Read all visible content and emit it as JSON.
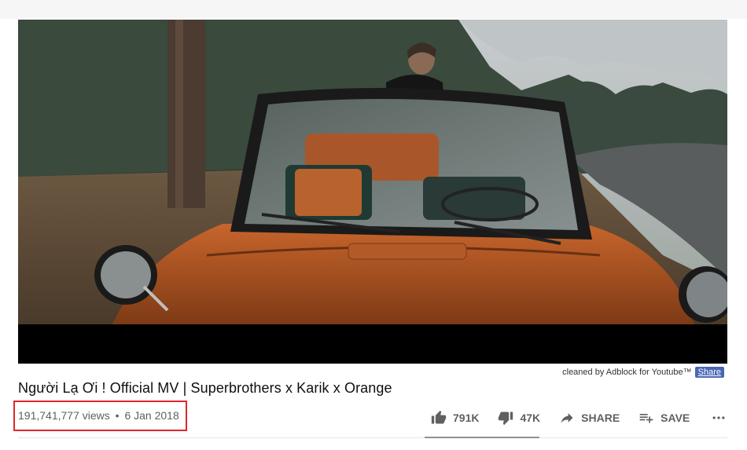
{
  "video": {
    "title": "Người Lạ Ơi ! Official MV | Superbrothers x Karik x Orange",
    "views": "191,741,777 views",
    "separator": "•",
    "date": "6 Jan 2018"
  },
  "adblock": {
    "text": "cleaned by Adblock for Youtube™",
    "share_label": "Share"
  },
  "actions": {
    "like_count": "791K",
    "dislike_count": "47K",
    "share_label": "SHARE",
    "save_label": "SAVE"
  },
  "sentiment": {
    "like_ratio": 0.94
  },
  "colors": {
    "highlight": "#e0262b",
    "icon": "#606060",
    "adblock_badge": "#4a67b5"
  },
  "icons": [
    "thumbs-up-icon",
    "thumbs-down-icon",
    "share-arrow-icon",
    "playlist-add-icon",
    "more-horizontal-icon"
  ]
}
